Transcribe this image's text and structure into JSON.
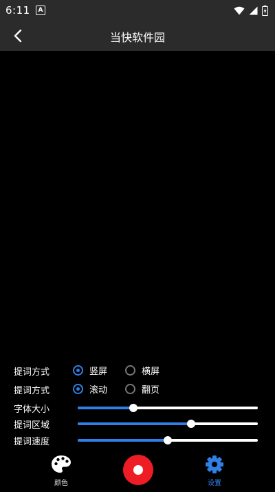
{
  "status_bar": {
    "time": "6:11",
    "app_icon_letter": "A"
  },
  "app_bar": {
    "title": "当快软件园"
  },
  "settings": {
    "orientation": {
      "label": "提词方式",
      "options": [
        {
          "label": "竖屏",
          "selected": true
        },
        {
          "label": "横屏",
          "selected": false
        }
      ]
    },
    "mode": {
      "label": "提词方式",
      "options": [
        {
          "label": "滚动",
          "selected": true
        },
        {
          "label": "翻页",
          "selected": false
        }
      ]
    },
    "font_size": {
      "label": "字体大小",
      "value_percent": 31
    },
    "area": {
      "label": "提词区域",
      "value_percent": 63
    },
    "speed": {
      "label": "提词速度",
      "value_percent": 50
    }
  },
  "bottom_nav": {
    "color_label": "颜色",
    "settings_label": "设置"
  },
  "colors": {
    "accent": "#2f7fe6",
    "record": "#ee1c24",
    "bar_background": "#2b2b2b"
  }
}
